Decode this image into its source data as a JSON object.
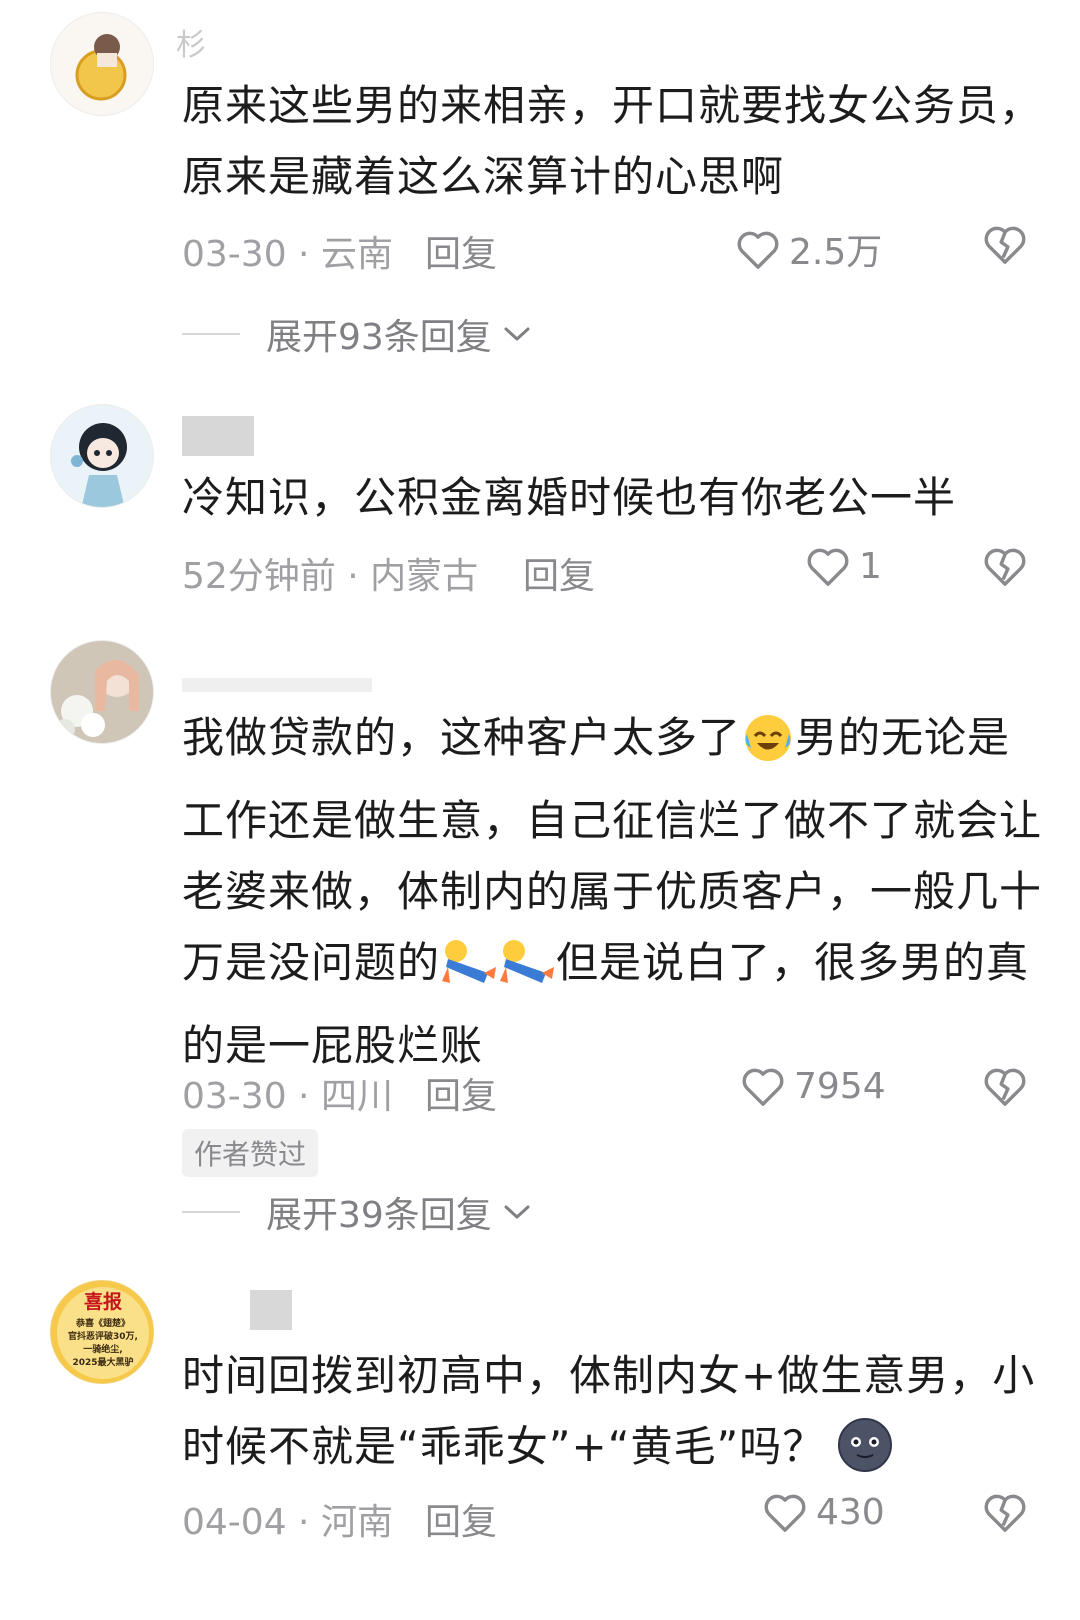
{
  "comments": [
    {
      "username": "杉",
      "text": "原来这些男的来相亲，开口就要找女公务员，原来是藏着这么深算计的心思啊",
      "date": "03-30",
      "location": "云南",
      "reply": "回复",
      "likes": "2.5万",
      "expand": "展开93条回复"
    },
    {
      "username": "",
      "text": "冷知识，公积金离婚时候也有你老公一半",
      "date": "52分钟前",
      "location": "内蒙古",
      "reply": "回复",
      "likes": "1"
    },
    {
      "username": "",
      "text_a": "我做贷款的，这种客户太多了",
      "text_b": "男的无论是工作还是做生意，自己征信烂了做不了就会让老婆来做，体制内的属于优质客户，一般几十万是没问题的",
      "text_c": "但是说白了，很多男的真的是一屁股烂账",
      "date": "03-30",
      "location": "四川",
      "reply": "回复",
      "likes": "7954",
      "badge": "作者赞过",
      "expand": "展开39条回复"
    },
    {
      "username": "",
      "avatar_text": {
        "title": "喜报",
        "line1": "恭喜《翅楚》",
        "line2": "官抖恶评破30万,",
        "line3": "一骑绝尘,",
        "line4": "2025最大黑驴"
      },
      "text_a": "时间回拨到初高中，体制内女+做生意男，小时候不就是“乖乖女”+“黄毛”吗？",
      "date": "04-04",
      "location": "河南",
      "reply": "回复",
      "likes": "430"
    }
  ],
  "separator": " · ",
  "icons": {
    "like": "heart-outline-icon",
    "dislike": "broken-heart-icon",
    "expand": "chevron-down-icon"
  }
}
